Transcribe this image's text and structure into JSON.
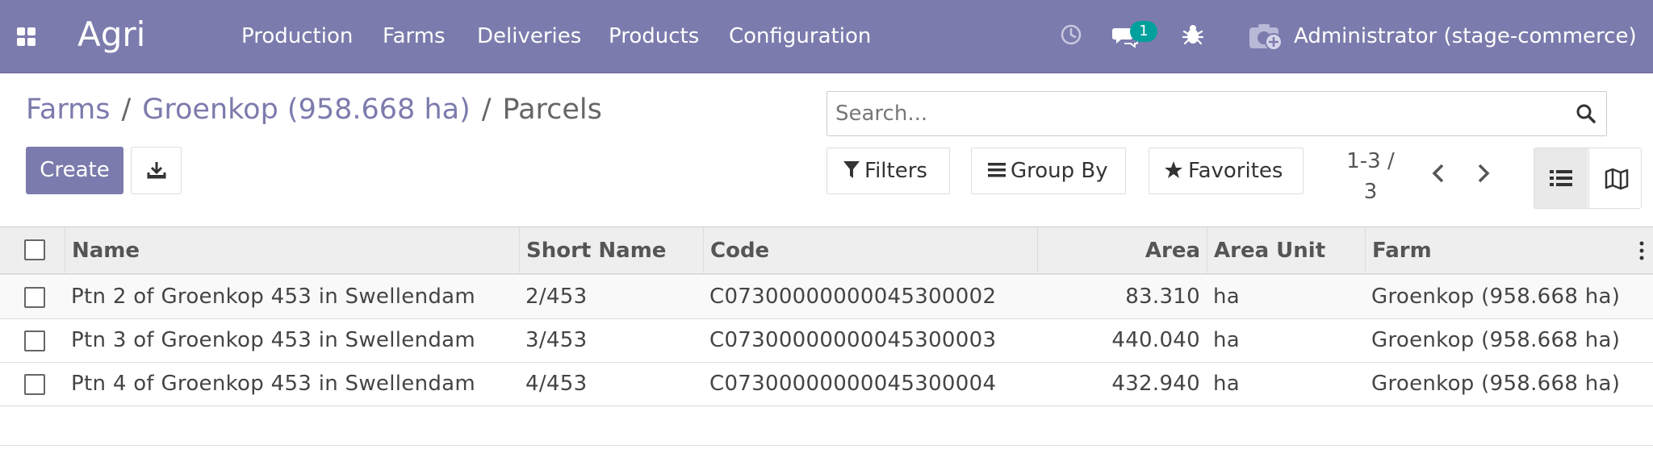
{
  "navbar": {
    "brand": "Agri",
    "menu": [
      "Production",
      "Farms",
      "Deliveries",
      "Products",
      "Configuration"
    ],
    "activity_icon": "clock-icon",
    "messages_badge": "1",
    "user_name": "Administrator (stage-commerce)",
    "colors": {
      "bar": "#7c7bad",
      "badge": "#00a09d"
    }
  },
  "breadcrumb": {
    "items": [
      "Farms",
      "Groenkop (958.668 ha)"
    ],
    "separator": "/",
    "current": "Parcels"
  },
  "actions": {
    "create_label": "Create",
    "download_icon": "download-icon"
  },
  "search": {
    "placeholder": "Search...",
    "value": ""
  },
  "filters": {
    "filters_label": "Filters",
    "group_by_label": "Group By",
    "favorites_label": "Favorites"
  },
  "pager": {
    "value": "1-3 /",
    "limit": "3"
  },
  "views": {
    "active": "list",
    "items": [
      "list-view-icon",
      "map-view-icon"
    ]
  },
  "table": {
    "columns": {
      "name": "Name",
      "short_name": "Short Name",
      "code": "Code",
      "area": "Area",
      "area_unit": "Area Unit",
      "farm": "Farm"
    },
    "rows": [
      {
        "name": "Ptn 2 of Groenkop 453 in Swellendam",
        "short_name": "2/453",
        "code": "C07300000000045300002",
        "area": "83.310",
        "area_unit": "ha",
        "farm": "Groenkop (958.668 ha)"
      },
      {
        "name": "Ptn 3 of Groenkop 453 in Swellendam",
        "short_name": "3/453",
        "code": "C07300000000045300003",
        "area": "440.040",
        "area_unit": "ha",
        "farm": "Groenkop (958.668 ha)"
      },
      {
        "name": "Ptn 4 of Groenkop 453 in Swellendam",
        "short_name": "4/453",
        "code": "C07300000000045300004",
        "area": "432.940",
        "area_unit": "ha",
        "farm": "Groenkop (958.668 ha)"
      }
    ]
  }
}
